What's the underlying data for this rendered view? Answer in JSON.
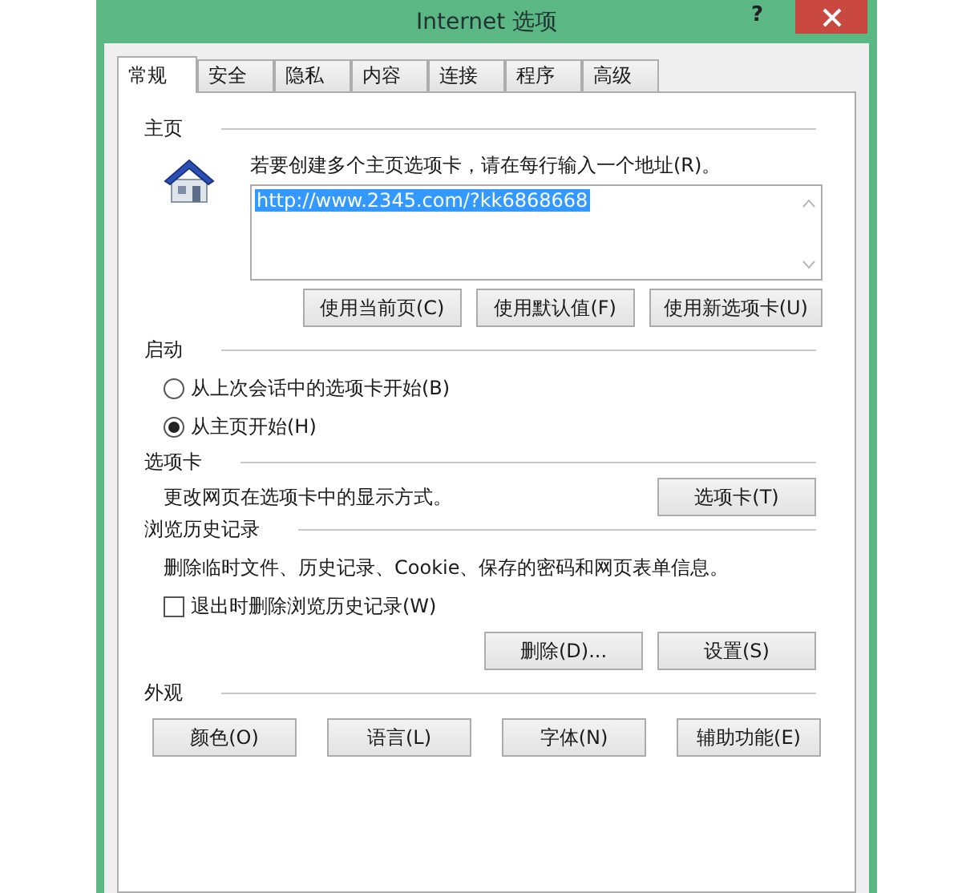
{
  "window": {
    "title": "Internet 选项",
    "help": "?"
  },
  "tabs": [
    {
      "label": "常规",
      "selected": true
    },
    {
      "label": "安全",
      "selected": false
    },
    {
      "label": "隐私",
      "selected": false
    },
    {
      "label": "内容",
      "selected": false
    },
    {
      "label": "连接",
      "selected": false
    },
    {
      "label": "程序",
      "selected": false
    },
    {
      "label": "高级",
      "selected": false
    }
  ],
  "home_page": {
    "heading": "主页",
    "description": "若要创建多个主页选项卡，请在每行输入一个地址(R)。",
    "value": "http://www.2345.com/?kk6868668",
    "text_selected": true,
    "buttons": [
      "使用当前页(C)",
      "使用默认值(F)",
      "使用新选项卡(U)"
    ]
  },
  "startup": {
    "heading": "启动",
    "options": [
      {
        "label": "从上次会话中的选项卡开始(B)",
        "selected": false
      },
      {
        "label": "从主页开始(H)",
        "selected": true
      }
    ]
  },
  "tabs_section": {
    "heading": "选项卡",
    "description": "更改网页在选项卡中的显示方式。",
    "button": "选项卡(T)"
  },
  "history": {
    "heading": "浏览历史记录",
    "description": "删除临时文件、历史记录、Cookie、保存的密码和网页表单信息。",
    "checkbox": {
      "label": "退出时删除浏览历史记录(W)",
      "checked": false
    },
    "buttons": [
      "删除(D)...",
      "设置(S)"
    ]
  },
  "appearance": {
    "heading": "外观",
    "buttons": [
      "颜色(O)",
      "语言(L)",
      "字体(N)",
      "辅助功能(E)"
    ]
  }
}
